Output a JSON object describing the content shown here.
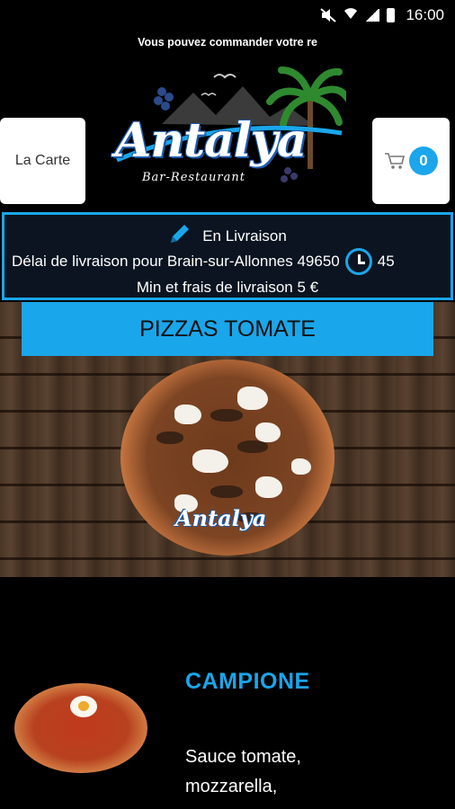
{
  "status_bar": {
    "time": "16:00"
  },
  "marquee": {
    "text": "Vous pouvez commander votre re"
  },
  "header": {
    "carte_label": "La Carte",
    "cart_count": "0",
    "logo_name": "Antalya",
    "logo_sub": "Bar-Restaurant"
  },
  "delivery": {
    "mode": "En Livraison",
    "delay_text": "Délai de livraison pour Brain-sur-Allonnes 49650",
    "delay_minutes": "45",
    "min_fee_text": "Min et frais de livraison 5 €"
  },
  "category": {
    "title": "PIZZAS TOMATE",
    "watermark": "Antalya"
  },
  "product": {
    "name": "CAMPIONE",
    "description": "Sauce tomate,\nmozzarella,"
  },
  "colors": {
    "accent": "#1aa6ea",
    "background": "#000000"
  }
}
